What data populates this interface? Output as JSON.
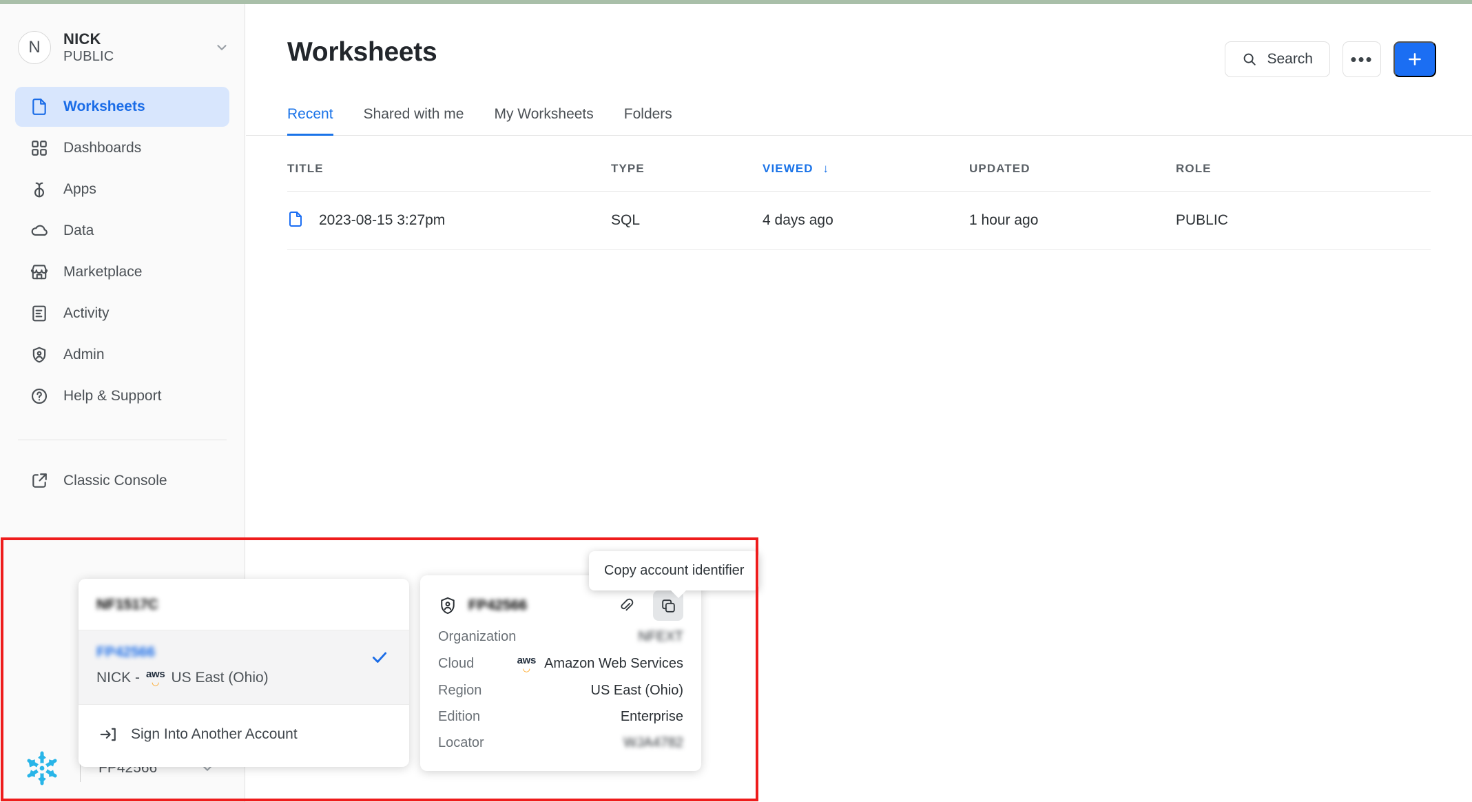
{
  "theme": {
    "accent_blue": "#1a73e8",
    "button_blue": "#1b6ef3",
    "active_nav_bg": "#d8e6fd",
    "annotation_red": "#ee1c1c",
    "snowflake_cyan": "#29b5e8",
    "top_strip": "#a9bfa9"
  },
  "sidebar": {
    "account": {
      "avatar_initial": "N",
      "name": "NICK",
      "role": "PUBLIC"
    },
    "items": [
      {
        "label": "Worksheets",
        "icon": "document-icon",
        "active": true
      },
      {
        "label": "Dashboards",
        "icon": "grid-icon",
        "active": false
      },
      {
        "label": "Apps",
        "icon": "apps-icon",
        "active": false
      },
      {
        "label": "Data",
        "icon": "cloud-icon",
        "active": false
      },
      {
        "label": "Marketplace",
        "icon": "storefront-icon",
        "active": false
      },
      {
        "label": "Activity",
        "icon": "activity-icon",
        "active": false
      },
      {
        "label": "Admin",
        "icon": "shield-user-icon",
        "active": false
      },
      {
        "label": "Help & Support",
        "icon": "question-icon",
        "active": false
      }
    ],
    "lower_items": [
      {
        "label": "Classic Console",
        "icon": "external-link-icon"
      }
    ],
    "footer": {
      "logo": "snowflake-logo",
      "account_label": "FP42566",
      "chevron": "chevron-down-icon"
    }
  },
  "header": {
    "title": "Worksheets",
    "search_label": "Search",
    "search_icon": "search-icon",
    "more_label": "•••",
    "plus_label": "+"
  },
  "tabs": [
    {
      "label": "Recent",
      "active": true
    },
    {
      "label": "Shared with me",
      "active": false
    },
    {
      "label": "My Worksheets",
      "active": false
    },
    {
      "label": "Folders",
      "active": false
    }
  ],
  "table": {
    "columns": [
      {
        "key": "title",
        "label": "TITLE",
        "sorted": false
      },
      {
        "key": "type",
        "label": "TYPE",
        "sorted": false
      },
      {
        "key": "viewed",
        "label": "VIEWED",
        "sorted": true,
        "sort_arrow": "↓"
      },
      {
        "key": "updated",
        "label": "UPDATED",
        "sorted": false
      },
      {
        "key": "role",
        "label": "ROLE",
        "sorted": false
      }
    ],
    "rows": [
      {
        "title": "2023-08-15 3:27pm",
        "type": "SQL",
        "viewed": "4 days ago",
        "updated": "1 hour ago",
        "role": "PUBLIC",
        "icon": "document-icon"
      }
    ]
  },
  "account_popup": {
    "org_heading": "NF1517C",
    "selected": {
      "account_id": "FP42566",
      "subtitle_prefix": "NICK -",
      "cloud_mark": "aws",
      "region": "US East (Ohio)",
      "check_icon": "check-icon"
    },
    "sign_in_label": "Sign Into Another Account",
    "sign_in_icon": "sign-in-icon"
  },
  "detail_card": {
    "shield_icon": "shield-user-icon",
    "account_name": "FP42566",
    "link_icon": "link-icon",
    "copy_icon": "copy-icon",
    "rows": [
      {
        "label": "Organization",
        "value": "NFEXT",
        "redacted": true
      },
      {
        "label": "Cloud",
        "value": "Amazon Web Services",
        "redacted": false,
        "mark": "aws"
      },
      {
        "label": "Region",
        "value": "US East (Ohio)",
        "redacted": false
      },
      {
        "label": "Edition",
        "value": "Enterprise",
        "redacted": false
      },
      {
        "label": "Locator",
        "value": "WJA4782",
        "redacted": true
      }
    ]
  },
  "tooltip": {
    "text": "Copy account identifier"
  }
}
